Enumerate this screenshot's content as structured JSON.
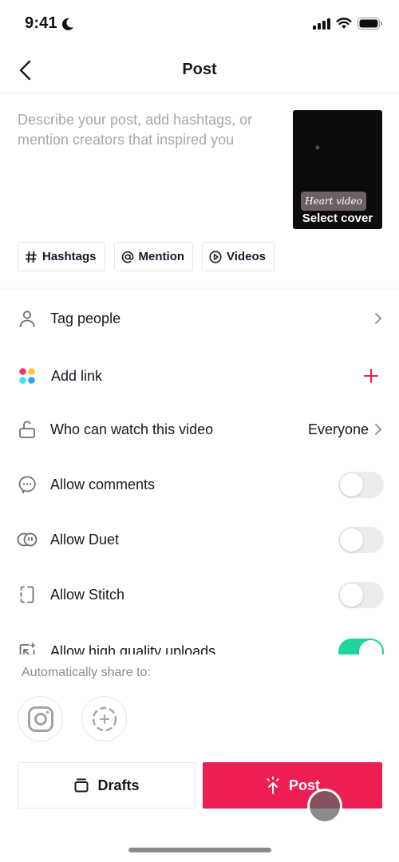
{
  "status_bar": {
    "time": "9:41",
    "icons": [
      "moon-icon",
      "cellular-signal-icon",
      "wifi-icon",
      "battery-icon"
    ]
  },
  "nav": {
    "title": "Post",
    "back_icon": "chevron-left-icon"
  },
  "caption": {
    "value": "",
    "placeholder": "Describe your post, add hashtags, or mention creators that inspired you"
  },
  "cover": {
    "overlay_text": "Heart video",
    "label": "Select cover"
  },
  "chips": [
    {
      "icon": "hashtag-icon",
      "label": "Hashtags"
    },
    {
      "icon": "at-sign-icon",
      "label": "Mention"
    },
    {
      "icon": "play-circle-icon",
      "label": "Videos"
    }
  ],
  "settings": {
    "tag_people": {
      "icon": "person-icon",
      "label": "Tag people",
      "action_icon": "chevron-right-icon"
    },
    "add_link": {
      "icon": "colored-dots-icon",
      "label": "Add link",
      "action_icon": "plus-icon"
    },
    "who_can_watch": {
      "icon": "unlock-icon",
      "label": "Who can watch this video",
      "value": "Everyone",
      "action_icon": "chevron-right-icon"
    },
    "allow_comments": {
      "icon": "comment-icon",
      "label": "Allow comments",
      "enabled": false
    },
    "allow_duet": {
      "icon": "duet-icon",
      "label": "Allow Duet",
      "enabled": false
    },
    "allow_stitch": {
      "icon": "stitch-icon",
      "label": "Allow Stitch",
      "enabled": false
    },
    "allow_hq_uploads": {
      "icon": "hq-upload-icon",
      "label": "Allow high quality uploads",
      "enabled": true
    }
  },
  "share": {
    "label": "Automatically share to:",
    "targets": [
      {
        "icon": "instagram-icon",
        "name": "Instagram"
      },
      {
        "icon": "add-circle-dashed-icon",
        "name": "Add"
      }
    ]
  },
  "actions": {
    "drafts_label": "Drafts",
    "post_label": "Post"
  },
  "colors": {
    "accent": "#ee1d52",
    "toggle_on": "#20d5a0",
    "toggle_off": "#ececee",
    "link_dot_red": "#ee3a6a",
    "link_dot_yellow": "#f7c344",
    "link_dot_cyan": "#3ce6f4",
    "link_dot_blue": "#2aa7f5"
  }
}
